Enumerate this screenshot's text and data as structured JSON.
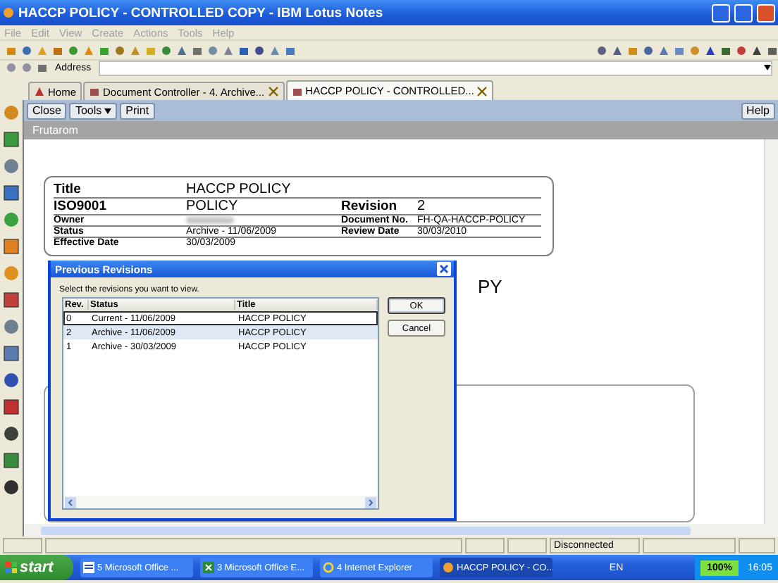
{
  "window": {
    "title": "HACCP POLICY - CONTROLLED COPY - IBM Lotus Notes"
  },
  "menu": [
    "File",
    "Edit",
    "View",
    "Create",
    "Actions",
    "Tools",
    "Help"
  ],
  "address": {
    "label": "Address"
  },
  "tabs": [
    {
      "label": "Home",
      "selected": false,
      "closable": false
    },
    {
      "label": "Document Controller - 4. Archive...",
      "selected": false,
      "closable": true
    },
    {
      "label": "HACCP POLICY - CONTROLLED...",
      "selected": true,
      "closable": true
    }
  ],
  "action_bar": {
    "buttons": [
      {
        "label": "Close",
        "kind": "plain"
      },
      {
        "label": "Tools",
        "kind": "menu"
      },
      {
        "label": "Print",
        "kind": "plain"
      }
    ],
    "help": "Help"
  },
  "form": {
    "header": "Frutarom",
    "rows": [
      {
        "kind": "large",
        "cells": [
          {
            "label": "Title",
            "value": "HACCP POLICY"
          }
        ]
      },
      {
        "kind": "large",
        "cells": [
          {
            "label": "ISO9001",
            "value": "POLICY"
          },
          {
            "label": "Revision",
            "value": "2"
          }
        ]
      },
      {
        "kind": "small",
        "cells": [
          {
            "label": "Owner",
            "blurred": true
          },
          {
            "label": "Document No.",
            "value": "FH-QA-HACCP-POLICY"
          }
        ]
      },
      {
        "kind": "small",
        "cells": [
          {
            "label": "Status",
            "value": "Archive - 11/06/2009"
          },
          {
            "label": "Review Date",
            "value": "30/03/2010"
          }
        ]
      },
      {
        "kind": "small",
        "cells": [
          {
            "label": "Effective Date",
            "value": "30/03/2009"
          }
        ]
      }
    ],
    "heading_fragment": "PY"
  },
  "dialog": {
    "title": "Previous Revisions",
    "prompt": "Select the revisions you want to view.",
    "columns": [
      "Rev.",
      "Status",
      "Title"
    ],
    "rows": [
      {
        "cells": [
          "0",
          "Current - 11/06/2009",
          "HACCP POLICY"
        ],
        "selected": false,
        "focused": true
      },
      {
        "cells": [
          "2",
          "Archive - 11/06/2009",
          "HACCP POLICY"
        ],
        "selected": true,
        "focused": false
      },
      {
        "cells": [
          "1",
          "Archive - 30/03/2009",
          "HACCP POLICY"
        ],
        "selected": false,
        "focused": false
      }
    ],
    "buttons": [
      {
        "label": "OK",
        "default": true
      },
      {
        "label": "Cancel",
        "default": false
      }
    ]
  },
  "status_bar": {
    "connection": "Disconnected"
  },
  "taskbar": {
    "start": "start",
    "items": [
      {
        "kind": "word",
        "label": "5 Microsoft Office ...",
        "selected": false
      },
      {
        "kind": "excel",
        "label": "3 Microsoft Office E...",
        "selected": false
      },
      {
        "kind": "ie",
        "label": "4 Internet Explorer",
        "selected": false
      },
      {
        "kind": "notes",
        "label": "HACCP POLICY - CO...",
        "selected": true
      }
    ],
    "language": "EN",
    "battery": "100%",
    "clock": "16:05"
  }
}
